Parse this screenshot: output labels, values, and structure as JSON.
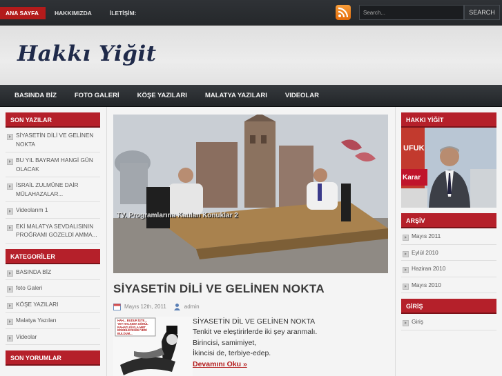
{
  "topnav": {
    "items": [
      {
        "label": "ANA SAYFA"
      },
      {
        "label": "HAKKIMIZDA"
      },
      {
        "label": "İLETİŞİM:"
      }
    ]
  },
  "search": {
    "placeholder": "Search...",
    "button_label": "SEARCH"
  },
  "header": {
    "site_title": "Hakkı Yiğit"
  },
  "mainnav": {
    "items": [
      {
        "label": "BASINDA BİZ"
      },
      {
        "label": "FOTO GALERİ"
      },
      {
        "label": "KÖŞE YAZILARI"
      },
      {
        "label": "MALATYA YAZILARI"
      },
      {
        "label": "VIDEOLAR"
      }
    ]
  },
  "left_sidebar": {
    "recent_title": "SON YAZILAR",
    "recent": [
      "SİYASETİN DİLİ VE GELİNEN NOKTA",
      "BU YIL BAYRAM HANGİ GÜN OLACAK",
      "İSRAİL ZULMÜNE DAİR MÜLAHAZALAR...",
      "Videolarım 1",
      "EKİ MALATYA SEVDALISININ PROĞRAMI GÖZELDİ AMMA..."
    ],
    "categories_title": "KATEGORİLER",
    "categories": [
      "BASINDA BİZ",
      "foto Galeri",
      "KÖŞE YAZILARI",
      "Malatya Yazıları",
      "Videolar"
    ],
    "comments_title": "SON YORUMLAR"
  },
  "slider": {
    "caption": "TV. Programlarına Katılan Konuklar 2"
  },
  "post": {
    "title": "SİYASETİN DİLİ VE GELİNEN NOKTA",
    "date": "Mayıs 12th, 2011",
    "author": "admin",
    "thumb_text": "HAH... BUDUR İŞTE... YET HALKIMA GÖNÜL RAHATLIĞIYLA MBT EDEBİLECEĞİM YERİ BULDUM...",
    "lines": [
      "SİYASETİN DİL VE GELİNEN NOKTA",
      "Tenkit ve eleştirirlerde iki şey aranmalı.",
      "Birincisi, samimiyet,",
      "İkincisi de, terbiye-edep."
    ],
    "read_more": "Devamını Oku »"
  },
  "right_sidebar": {
    "profile_title": "HAKKI YİĞİT",
    "photo_sign_1": "UFUK",
    "photo_sign_2": "Karar",
    "archive_title": "ARŞİV",
    "archive": [
      "Mayıs 2011",
      "Eylül 2010",
      "Haziran 2010",
      "Mayıs 2010"
    ],
    "login_title": "GİRİŞ",
    "login": [
      "Giriş"
    ]
  },
  "colors": {
    "accent": "#b5202a",
    "topbar": "#2a2d31",
    "rss": "#ef8a23"
  }
}
